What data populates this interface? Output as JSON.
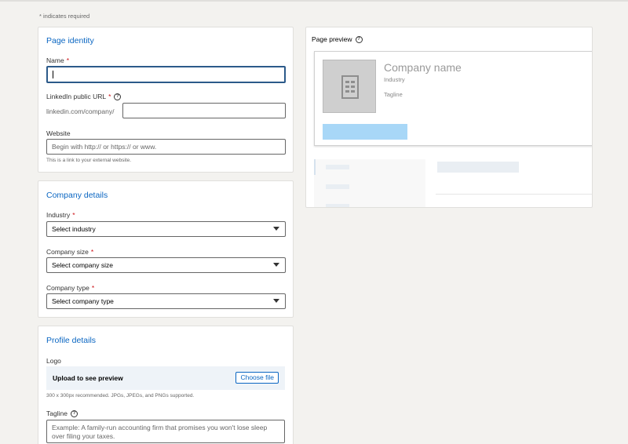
{
  "required_note": "* indicates required",
  "page_identity": {
    "title": "Page identity",
    "name_label": "Name",
    "name_value": "",
    "url_label": "LinkedIn public URL",
    "url_prefix": "linkedin.com/company/",
    "url_value": "",
    "website_label": "Website",
    "website_placeholder": "Begin with http:// or https:// or www.",
    "website_hint": "This is a link to your external website."
  },
  "company_details": {
    "title": "Company details",
    "industry_label": "Industry",
    "industry_value": "Select industry",
    "size_label": "Company size",
    "size_value": "Select company size",
    "type_label": "Company type",
    "type_value": "Select company type"
  },
  "profile_details": {
    "title": "Profile details",
    "logo_label": "Logo",
    "upload_text": "Upload to see preview",
    "choose_file": "Choose file",
    "logo_hint": "300 x 300px recommended. JPGs, JPEGs, and PNGs supported.",
    "tagline_label": "Tagline",
    "tagline_placeholder": "Example: A family-run accounting firm that promises you won't lose sleep over filing your taxes."
  },
  "preview": {
    "title": "Page preview",
    "company_name": "Company name",
    "industry": "Industry",
    "tagline": "Tagline"
  },
  "required_mark": "*",
  "help_mark": "?",
  "colors": {
    "accent": "#0a66c2",
    "required": "#cc1016",
    "background": "#f3f2ef",
    "preview_button": "#a8d7f7"
  }
}
